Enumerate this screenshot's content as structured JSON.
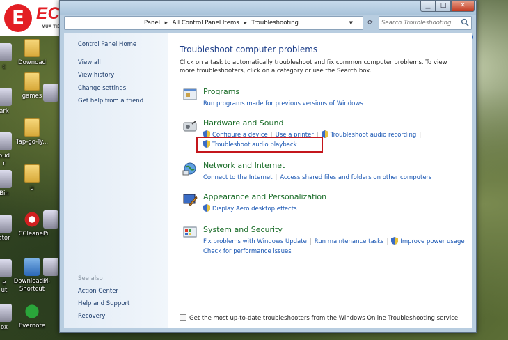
{
  "logo": {
    "mark": "E",
    "brand": "ECO-MART",
    "reg": "®",
    "tagline": "MUA TIẾT KIỆM - SẮM AN TÂM"
  },
  "desktop": {
    "icons": [
      {
        "label": "Downoad"
      },
      {
        "label": "games"
      },
      {
        "label": "Tap-go-Ty..."
      },
      {
        "label": "u"
      },
      {
        "label": "CCleaner"
      },
      {
        "label": "Downloads - Shortcut"
      },
      {
        "label": "Evernote"
      }
    ],
    "edge_fragments": [
      "c",
      "ark",
      "oud",
      "r",
      "Bin",
      "ator",
      "e",
      "ut",
      "ox",
      "Pi",
      "Pi"
    ]
  },
  "window": {
    "title_buttons": {
      "minimize": "▁",
      "maximize": "□",
      "close": "✕"
    },
    "address": {
      "crumbs": [
        "Panel",
        "All Control Panel Items",
        "Troubleshooting"
      ],
      "separator": "▸",
      "dropdown": "▼"
    },
    "refresh": "⟳",
    "search_placeholder": "Search Troubleshooting",
    "help": "?"
  },
  "left_pane": {
    "control_panel_home": "Control Panel Home",
    "links": [
      "View all",
      "View history",
      "Change settings",
      "Get help from a friend"
    ],
    "see_also_label": "See also",
    "see_also": [
      "Action Center",
      "Help and Support",
      "Recovery"
    ]
  },
  "main": {
    "title": "Troubleshoot computer problems",
    "description": "Click on a task to automatically troubleshoot and fix common computer problems. To view more troubleshooters, click on a category or use the Search box.",
    "categories": [
      {
        "title": "Programs",
        "links": [
          "Run programs made for previous versions of Windows"
        ]
      },
      {
        "title": "Hardware and Sound",
        "links": [
          "Configure a device",
          "Use a printer",
          "Troubleshoot audio recording"
        ],
        "extra_link": "Troubleshoot audio playback"
      },
      {
        "title": "Network and Internet",
        "links": [
          "Connect to the Internet",
          "Access shared files and folders on other computers"
        ]
      },
      {
        "title": "Appearance and Personalization",
        "links": [
          "Display Aero desktop effects"
        ]
      },
      {
        "title": "System and Security",
        "links": [
          "Fix problems with Windows Update",
          "Run maintenance tasks",
          "Improve power usage"
        ],
        "extra_link": "Check for performance issues"
      }
    ],
    "footer_checkbox_label": "Get the most up-to-date troubleshooters from the Windows Online Troubleshooting service"
  },
  "colors": {
    "brand_red": "#e31e24",
    "link_blue": "#1956b3",
    "category_green": "#1c6e2a",
    "title_blue": "#1e3f8a",
    "highlight_red": "#c4161c"
  }
}
